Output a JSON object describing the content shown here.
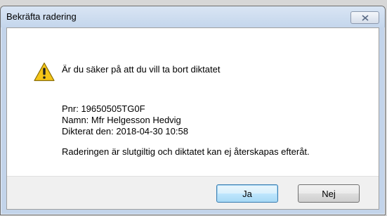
{
  "dialog": {
    "title": "Bekräfta radering",
    "close_icon": "close-x-icon",
    "warning_icon": "warning-triangle-icon",
    "question": "Är du säker på att du vill ta bort diktatet",
    "details": [
      "Pnr: 19650505TG0F",
      "Namn: Mfr Helgesson Hedvig",
      "Dikterat den: 2018-04-30 10:58"
    ],
    "finality": "Raderingen är slutgiltig och diktatet kan ej återskapas efteråt.",
    "buttons": {
      "yes": "Ja",
      "no": "Nej"
    }
  },
  "colors": {
    "titlebar": "#c4d6ec",
    "warning_yellow": "#f5c518",
    "default_button_border": "#3c7fb1"
  }
}
